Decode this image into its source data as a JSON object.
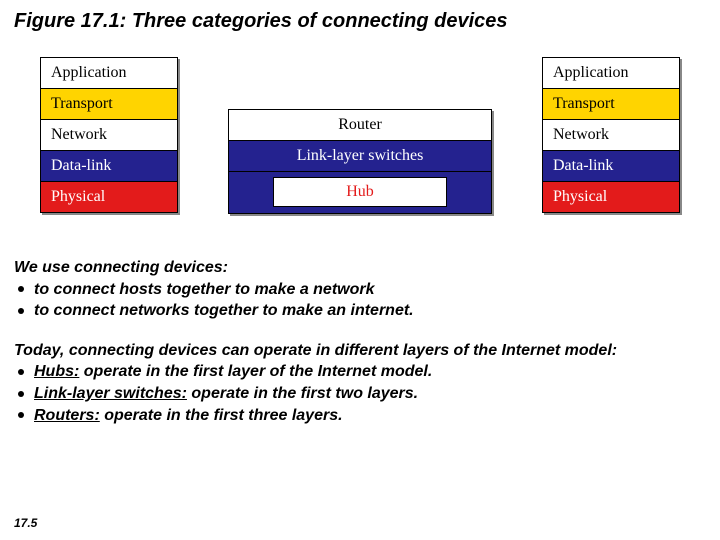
{
  "title": {
    "fig": "Figure 17.1:",
    "rest": " Three  categories of connecting devices"
  },
  "left": {
    "app": "Application",
    "trans": "Transport",
    "net": "Network",
    "dl": "Data-link",
    "phy": "Physical"
  },
  "right": {
    "app": "Application",
    "trans": "Transport",
    "net": "Network",
    "dl": "Data-link",
    "phy": "Physical"
  },
  "center": {
    "router": "Router",
    "lls": "Link-layer switches",
    "hub": "Hub"
  },
  "text1": {
    "lead": "We use connecting devices:",
    "b1": "to connect hosts together to make a network",
    "b2": "to connect networks together to make an internet."
  },
  "text2": {
    "lead": "Today, connecting devices can operate in different layers of the Internet model:",
    "hubs_label": "Hubs:",
    "hubs_rest": " operate in the first layer of the Internet model.",
    "lls_label": "Link-layer switches:",
    "lls_rest": " operate in the first two layers.",
    "rtr_label": "Routers:",
    "rtr_rest": " operate in the first three layers."
  },
  "page": "17.5"
}
